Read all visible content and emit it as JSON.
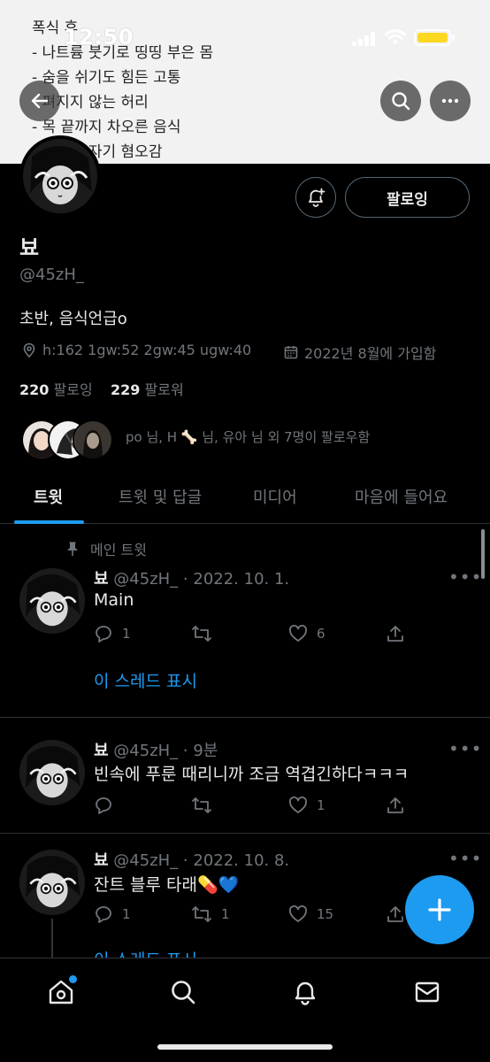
{
  "status_bar": {
    "time": "12:50"
  },
  "banner": {
    "lines": [
      "폭식 후",
      "- 나트륨 붓기로 띵띵 부은 몸",
      "- 숨을 쉬기도 힘든 고통",
      "- 펴지지 않는 허리",
      "- 목 끝까지 차오른 음식",
      "- 폭식한 자기 혐오감"
    ]
  },
  "header": {
    "back_label": "back",
    "search_label": "search",
    "more_label": "more"
  },
  "profile": {
    "name": "뵤",
    "handle": "@45zH_",
    "bio": "초반, 음식언급o",
    "location": "h:162 1gw:52 2gw:45 ugw:40",
    "joined": "2022년 8월에 가입함",
    "following_count": "220",
    "following_label": "팔로잉",
    "followers_count": "229",
    "followers_label": "팔로워",
    "follow_button": "팔로잉",
    "followed_by": "po 님, H 🦴 님, 유아 님 외 7명이 팔로우함"
  },
  "tabs": [
    "트윗",
    "트윗 및 답글",
    "미디어",
    "마음에 들어요"
  ],
  "pinned_label": "메인 트윗",
  "tweets": [
    {
      "name": "뵤",
      "handle": "@45zH_",
      "time": "· 2022. 10. 1.",
      "text": "Main",
      "replies": "1",
      "retweets": "",
      "likes": "6",
      "thread": "이 스레드 표시"
    },
    {
      "name": "뵤",
      "handle": "@45zH_",
      "time": "· 9분",
      "text": "빈속에 푸룬 때리니까 조금 역겹긴하다ㅋㅋㅋ",
      "replies": "",
      "retweets": "",
      "likes": "1"
    },
    {
      "name": "뵤",
      "handle": "@45zH_",
      "time": "· 2022. 10. 8.",
      "text": "잔트 블루 타래💊💙",
      "replies": "1",
      "retweets": "1",
      "likes": "15",
      "thread": "이 스레드 표시"
    }
  ],
  "colors": {
    "accent": "#1d9bf0",
    "background": "#000000",
    "muted": "#71767b",
    "text": "#e7e9ea"
  },
  "icons": [
    "back-arrow-icon",
    "search-icon",
    "more-icon",
    "bell-plus-icon",
    "location-icon",
    "calendar-icon",
    "pin-icon",
    "reply-icon",
    "retweet-icon",
    "like-icon",
    "share-icon",
    "compose-plus-icon",
    "home-icon",
    "explore-icon",
    "notifications-icon",
    "messages-icon"
  ]
}
